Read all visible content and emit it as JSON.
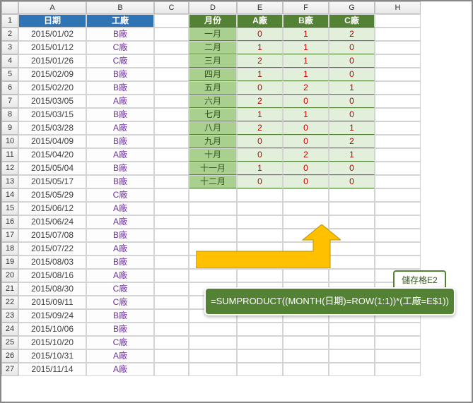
{
  "columns": [
    "A",
    "B",
    "C",
    "D",
    "E",
    "F",
    "G",
    "H"
  ],
  "leftHeaders": {
    "date": "日期",
    "factory": "工廠"
  },
  "leftRows": [
    {
      "date": "2015/01/02",
      "fac": "B廠"
    },
    {
      "date": "2015/01/12",
      "fac": "C廠"
    },
    {
      "date": "2015/01/26",
      "fac": "C廠"
    },
    {
      "date": "2015/02/09",
      "fac": "B廠"
    },
    {
      "date": "2015/02/20",
      "fac": "B廠"
    },
    {
      "date": "2015/03/05",
      "fac": "A廠"
    },
    {
      "date": "2015/03/15",
      "fac": "B廠"
    },
    {
      "date": "2015/03/28",
      "fac": "A廠"
    },
    {
      "date": "2015/04/09",
      "fac": "B廠"
    },
    {
      "date": "2015/04/20",
      "fac": "A廠"
    },
    {
      "date": "2015/05/04",
      "fac": "B廠"
    },
    {
      "date": "2015/05/17",
      "fac": "B廠"
    },
    {
      "date": "2015/05/29",
      "fac": "C廠"
    },
    {
      "date": "2015/06/12",
      "fac": "A廠"
    },
    {
      "date": "2015/06/24",
      "fac": "A廠"
    },
    {
      "date": "2015/07/08",
      "fac": "B廠"
    },
    {
      "date": "2015/07/22",
      "fac": "A廠"
    },
    {
      "date": "2015/08/03",
      "fac": "B廠"
    },
    {
      "date": "2015/08/16",
      "fac": "A廠"
    },
    {
      "date": "2015/08/30",
      "fac": "C廠"
    },
    {
      "date": "2015/09/11",
      "fac": "C廠"
    },
    {
      "date": "2015/09/24",
      "fac": "B廠"
    },
    {
      "date": "2015/10/06",
      "fac": "B廠"
    },
    {
      "date": "2015/10/20",
      "fac": "C廠"
    },
    {
      "date": "2015/10/31",
      "fac": "A廠"
    },
    {
      "date": "2015/11/14",
      "fac": "A廠"
    }
  ],
  "rightHeaders": {
    "month": "月份",
    "A": "A廠",
    "B": "B廠",
    "C": "C廠"
  },
  "rightRows": [
    {
      "m": "一月",
      "a": "0",
      "b": "1",
      "c": "2"
    },
    {
      "m": "二月",
      "a": "1",
      "b": "1",
      "c": "0"
    },
    {
      "m": "三月",
      "a": "2",
      "b": "1",
      "c": "0"
    },
    {
      "m": "四月",
      "a": "1",
      "b": "1",
      "c": "0"
    },
    {
      "m": "五月",
      "a": "0",
      "b": "2",
      "c": "1"
    },
    {
      "m": "六月",
      "a": "2",
      "b": "0",
      "c": "0"
    },
    {
      "m": "七月",
      "a": "1",
      "b": "1",
      "c": "0"
    },
    {
      "m": "八月",
      "a": "2",
      "b": "0",
      "c": "1"
    },
    {
      "m": "九月",
      "a": "0",
      "b": "0",
      "c": "2"
    },
    {
      "m": "十月",
      "a": "0",
      "b": "2",
      "c": "1"
    },
    {
      "m": "十一月",
      "a": "1",
      "b": "0",
      "c": "0"
    },
    {
      "m": "十二月",
      "a": "0",
      "b": "0",
      "c": "0"
    }
  ],
  "label": "儲存格E2",
  "formula": "=SUMPRODUCT((MONTH(日期)=ROW(1:1))*(工廠=E$1))",
  "chart_data": {
    "type": "table",
    "title": "月份統計",
    "categories": [
      "一月",
      "二月",
      "三月",
      "四月",
      "五月",
      "六月",
      "七月",
      "八月",
      "九月",
      "十月",
      "十一月",
      "十二月"
    ],
    "series": [
      {
        "name": "A廠",
        "values": [
          0,
          1,
          2,
          1,
          0,
          2,
          1,
          2,
          0,
          0,
          1,
          0
        ]
      },
      {
        "name": "B廠",
        "values": [
          1,
          1,
          1,
          1,
          2,
          0,
          1,
          0,
          0,
          2,
          0,
          0
        ]
      },
      {
        "name": "C廠",
        "values": [
          2,
          0,
          0,
          0,
          1,
          0,
          0,
          1,
          2,
          1,
          0,
          0
        ]
      }
    ]
  }
}
